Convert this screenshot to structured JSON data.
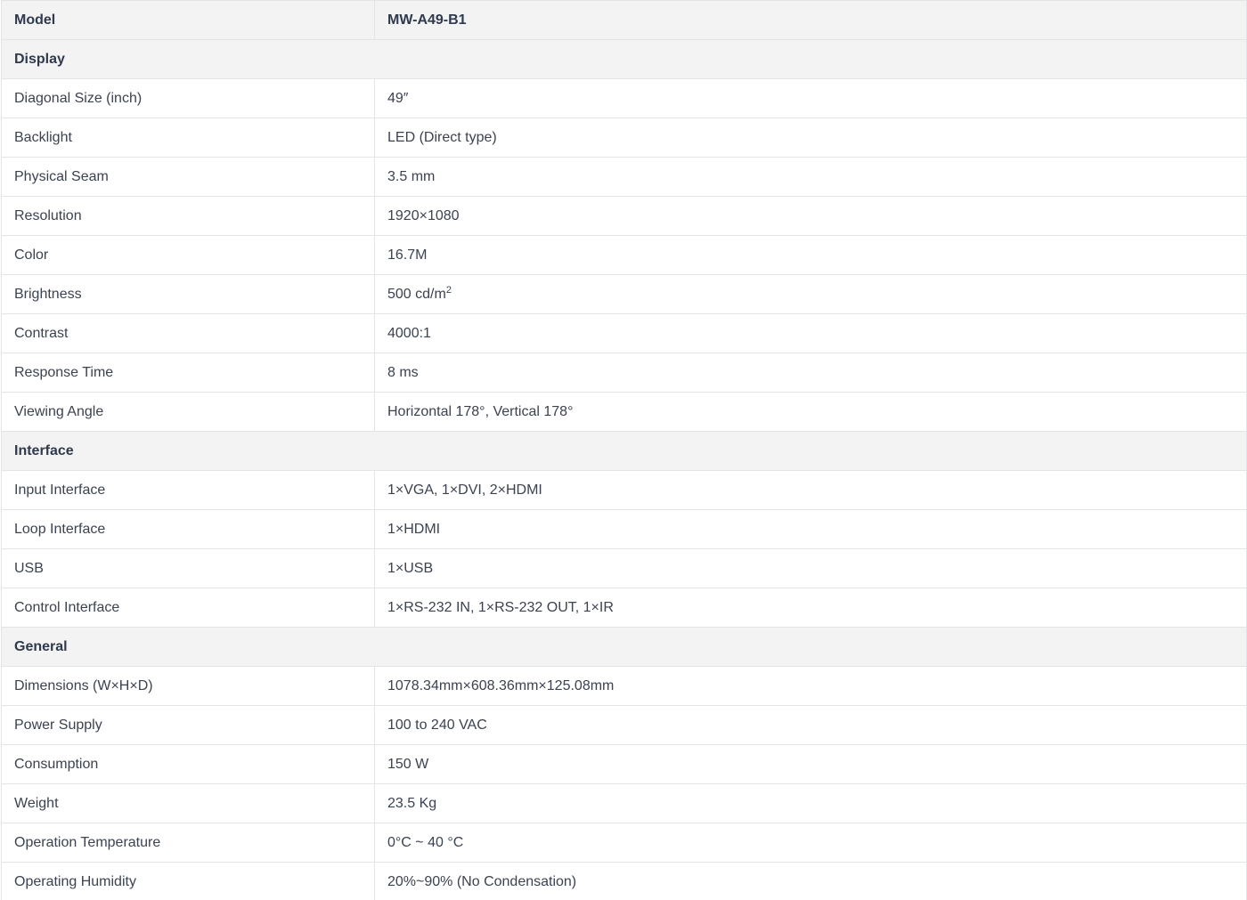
{
  "model": {
    "label": "Model",
    "value": "MW-A49-B1"
  },
  "sections": [
    {
      "title": "Display",
      "rows": [
        {
          "label": "Diagonal Size (inch)",
          "value": "49″"
        },
        {
          "label": "Backlight",
          "value": "LED (Direct type)"
        },
        {
          "label": "Physical Seam",
          "value": "3.5 mm"
        },
        {
          "label": "Resolution",
          "value": "1920×1080"
        },
        {
          "label": "Color",
          "value": "16.7M"
        },
        {
          "label": "Brightness",
          "value": "500 cd/m",
          "sup": "2"
        },
        {
          "label": "Contrast",
          "value": "4000:1"
        },
        {
          "label": "Response Time",
          "value": "8 ms"
        },
        {
          "label": "Viewing Angle",
          "value": "Horizontal 178°, Vertical 178°"
        }
      ]
    },
    {
      "title": "Interface",
      "rows": [
        {
          "label": "Input Interface",
          "value": "1×VGA, 1×DVI, 2×HDMI"
        },
        {
          "label": "Loop Interface",
          "value": "1×HDMI"
        },
        {
          "label": "USB",
          "value": "1×USB"
        },
        {
          "label": "Control Interface",
          "value": "1×RS-232 IN, 1×RS-232 OUT, 1×IR"
        }
      ]
    },
    {
      "title": "General",
      "rows": [
        {
          "label": "Dimensions (W×H×D)",
          "value": "1078.34mm×608.36mm×125.08mm"
        },
        {
          "label": "Power Supply",
          "value": "100 to 240 VAC"
        },
        {
          "label": "Consumption",
          "value": "150 W"
        },
        {
          "label": "Weight",
          "value": "23.5 Kg"
        },
        {
          "label": "Operation Temperature",
          "value": "0°C ~ 40 °C"
        },
        {
          "label": "Operating Humidity",
          "value": "20%~90% (No Condensation)"
        }
      ]
    }
  ]
}
